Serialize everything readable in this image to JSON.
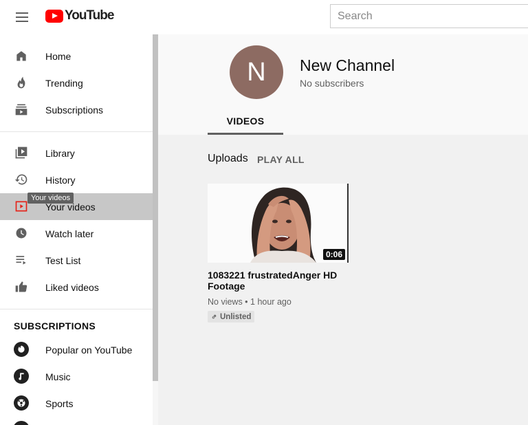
{
  "header": {
    "logo_text": "YouTube",
    "search_placeholder": "Search"
  },
  "sidebar": {
    "items": [
      {
        "label": "Home",
        "icon": "home-icon"
      },
      {
        "label": "Trending",
        "icon": "trending-icon"
      },
      {
        "label": "Subscriptions",
        "icon": "subscriptions-icon"
      },
      {
        "label": "Library",
        "icon": "library-icon"
      },
      {
        "label": "History",
        "icon": "history-icon"
      },
      {
        "label": "Your videos",
        "icon": "your-videos-icon",
        "active": true
      },
      {
        "label": "Watch later",
        "icon": "clock-icon"
      },
      {
        "label": "Test List",
        "icon": "playlist-icon"
      },
      {
        "label": "Liked videos",
        "icon": "thumbs-up-icon"
      }
    ],
    "tooltip": "Your videos",
    "subscriptions_title": "SUBSCRIPTIONS",
    "subscriptions": [
      {
        "label": "Popular on YouTube"
      },
      {
        "label": "Music"
      },
      {
        "label": "Sports"
      }
    ]
  },
  "channel": {
    "avatar_letter": "N",
    "avatar_color": "#8d6b62",
    "name": "New Channel",
    "subscribers": "No subscribers",
    "tab_videos": "VIDEOS"
  },
  "uploads": {
    "title": "Uploads",
    "play_all": "PLAY ALL",
    "videos": [
      {
        "title": "1083221 frustratedAnger HD Footage",
        "duration": "0:06",
        "meta": "No views • 1 hour ago",
        "badge": "Unlisted"
      }
    ]
  },
  "colors": {
    "brand_red": "#ff0000",
    "active_item_bg": "#c7c7c7"
  }
}
